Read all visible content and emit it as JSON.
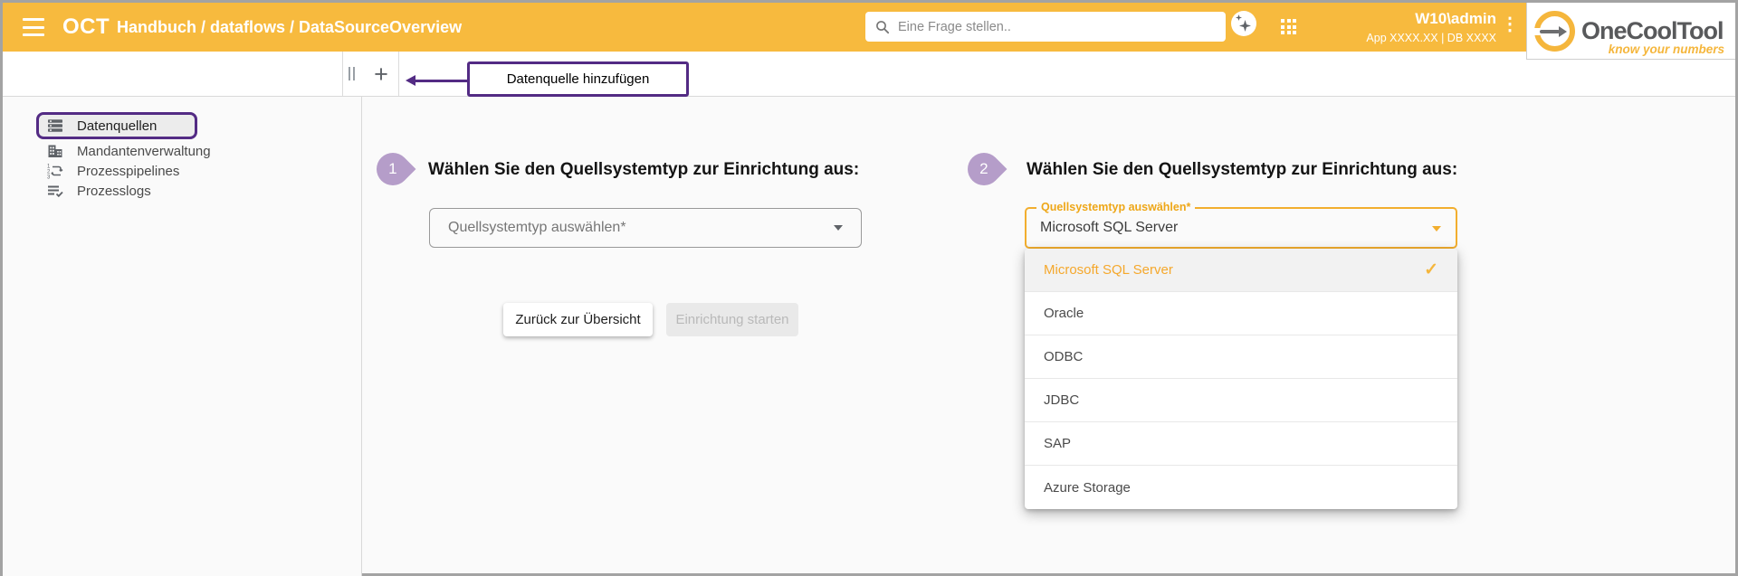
{
  "header": {
    "app_title": "OCT",
    "breadcrumb": "Handbuch / dataflows / DataSourceOverview",
    "search": {
      "placeholder": "Eine Frage stellen.."
    },
    "user_name": "W10\\admin",
    "app_info": "App XXXX.XX | DB XXXX"
  },
  "logo": {
    "name": "OneCoolTool",
    "tagline": "know your numbers"
  },
  "toolbar": {
    "add_glyph": "+",
    "annotation": "Datenquelle hinzufügen"
  },
  "sidebar": {
    "items": [
      {
        "label": "Datenquellen",
        "icon": "storage-list-icon",
        "active": true
      },
      {
        "label": "Mandantenverwaltung",
        "icon": "building-icon",
        "active": false
      },
      {
        "label": "Prozesspipelines",
        "icon": "numbered-pipeline-icon",
        "active": false
      },
      {
        "label": "Prozesslogs",
        "icon": "list-check-icon",
        "active": false
      }
    ]
  },
  "step1": {
    "number": "1",
    "heading": "Wählen Sie den Quellsystemtyp zur Einrichtung aus:",
    "select_placeholder": "Quellsystemtyp auswählen*",
    "back_button": "Zurück zur Übersicht",
    "start_button": "Einrichtung starten"
  },
  "step2": {
    "number": "2",
    "heading": "Wählen Sie den Quellsystemtyp zur Einrichtung aus:",
    "select_label": "Quellsystemtyp auswählen*",
    "select_value": "Microsoft SQL Server",
    "options": [
      {
        "label": "Microsoft SQL Server",
        "selected": true
      },
      {
        "label": "Oracle",
        "selected": false
      },
      {
        "label": "ODBC",
        "selected": false
      },
      {
        "label": "JDBC",
        "selected": false
      },
      {
        "label": "SAP",
        "selected": false
      },
      {
        "label": "Azure Storage",
        "selected": false
      }
    ]
  },
  "icons": {
    "kebab": "⋮",
    "check": "✓"
  },
  "colors": {
    "header_amber": "#f7ba3e",
    "accent_amber": "#f2ae2e",
    "annotation_purple": "#532b84",
    "step_lavender": "#b59dc9",
    "logo_gray": "#58595b"
  }
}
